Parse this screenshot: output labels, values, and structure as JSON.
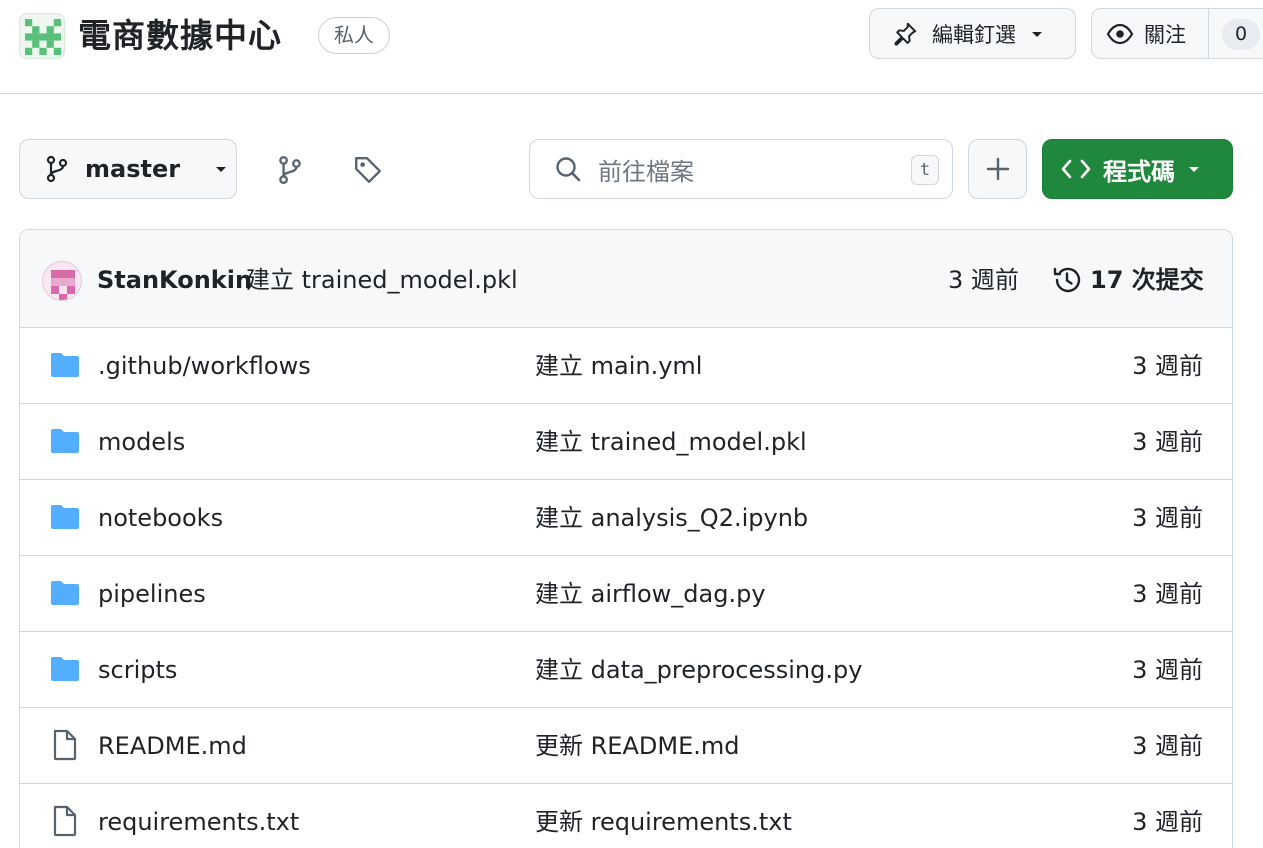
{
  "header": {
    "repo_title": "電商數據中心",
    "visibility": "私人",
    "pin_label": "編輯釘選",
    "watch_label": "關注",
    "watch_count": "0"
  },
  "toolbar": {
    "branch": "master",
    "search_placeholder": "前往檔案",
    "search_shortcut": "t",
    "code_label": "程式碼"
  },
  "latest_commit": {
    "author": "StanKonkin",
    "message": "建立 trained_model.pkl",
    "time": "3 週前",
    "commit_count": "17 次提交"
  },
  "files": [
    {
      "type": "folder",
      "name": ".github/workflows",
      "commit": "建立 main.yml",
      "time": "3 週前"
    },
    {
      "type": "folder",
      "name": "models",
      "commit": "建立 trained_model.pkl",
      "time": "3 週前"
    },
    {
      "type": "folder",
      "name": "notebooks",
      "commit": "建立 analysis_Q2.ipynb",
      "time": "3 週前"
    },
    {
      "type": "folder",
      "name": "pipelines",
      "commit": "建立 airflow_dag.py",
      "time": "3 週前"
    },
    {
      "type": "folder",
      "name": "scripts",
      "commit": "建立 data_preprocessing.py",
      "time": "3 週前"
    },
    {
      "type": "file",
      "name": "README.md",
      "commit": "更新 README.md",
      "time": "3 週前"
    },
    {
      "type": "file",
      "name": "requirements.txt",
      "commit": "更新 requirements.txt",
      "time": "3 週前"
    }
  ],
  "colors": {
    "accent_green": "#1f883d",
    "folder_blue": "#54aeff",
    "border": "#d0d7de"
  }
}
